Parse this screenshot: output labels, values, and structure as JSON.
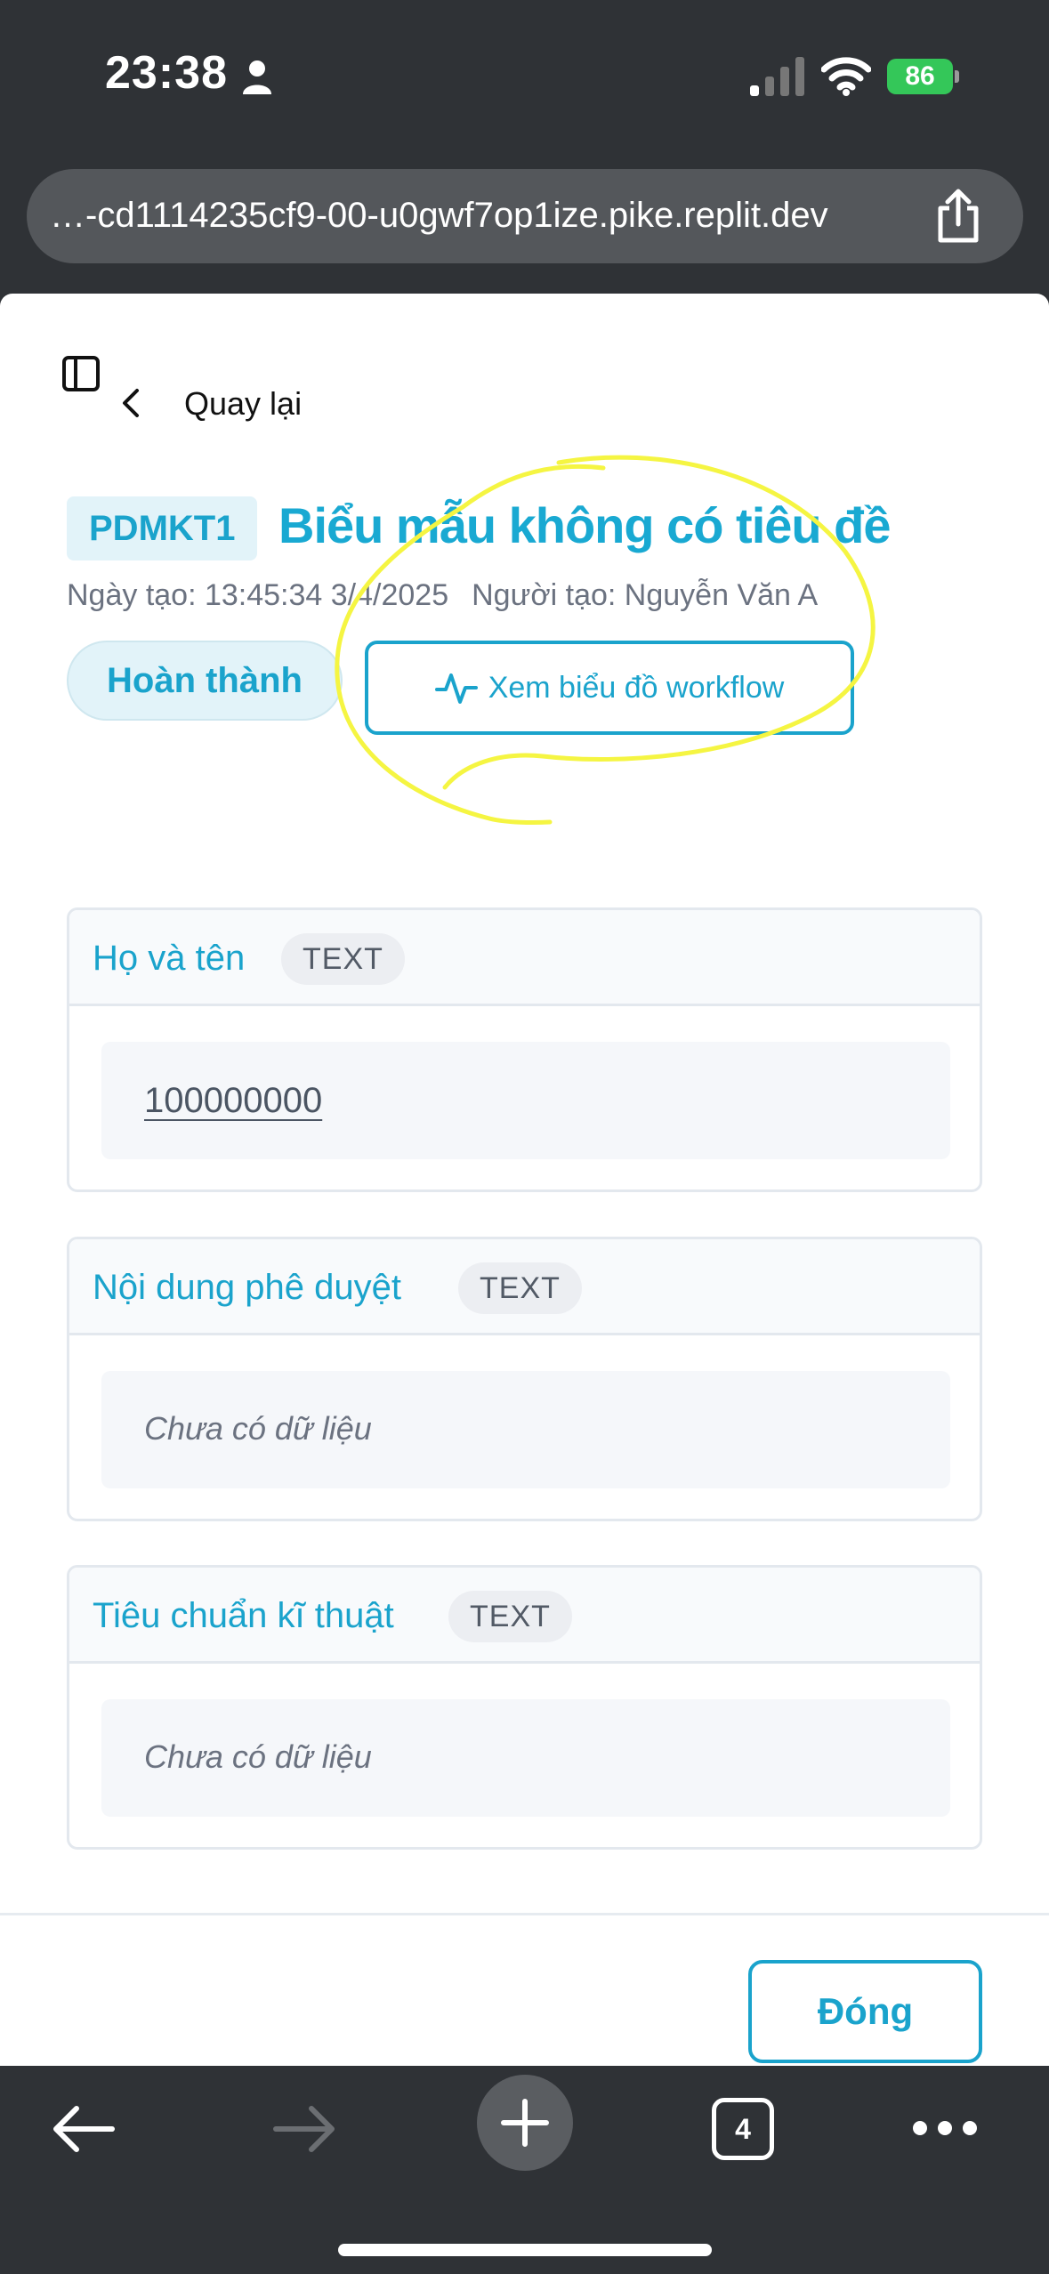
{
  "status_bar": {
    "time": "23:38",
    "battery": "86"
  },
  "browser": {
    "url": "…-cd1114235cf9-00-u0gwf7op1ize.pike.replit.dev",
    "tab_count": "4"
  },
  "nav": {
    "back_label": "Quay lại"
  },
  "form": {
    "code": "PDMKT1",
    "title": "Biểu mẫu không có tiêu đề",
    "created_at": "Ngày tạo: 13:45:34 3/4/2025",
    "created_by": "Người tạo: Nguyễn Văn A",
    "status": "Hoàn thành",
    "workflow_button": "Xem biểu đồ workflow"
  },
  "fields": [
    {
      "label": "Họ và tên",
      "type": "TEXT",
      "value": "100000000"
    },
    {
      "label": "Nội dung phê duyệt",
      "type": "TEXT",
      "value": "Chưa có dữ liệu"
    },
    {
      "label": "Tiêu chuẩn kĩ thuật",
      "type": "TEXT",
      "value": "Chưa có dữ liệu"
    }
  ],
  "footer": {
    "close_label": "Đóng"
  },
  "colors": {
    "accent": "#1aa3cc",
    "title": "#19a9d2",
    "annotation": "#f5f542",
    "battery": "#34c759"
  }
}
